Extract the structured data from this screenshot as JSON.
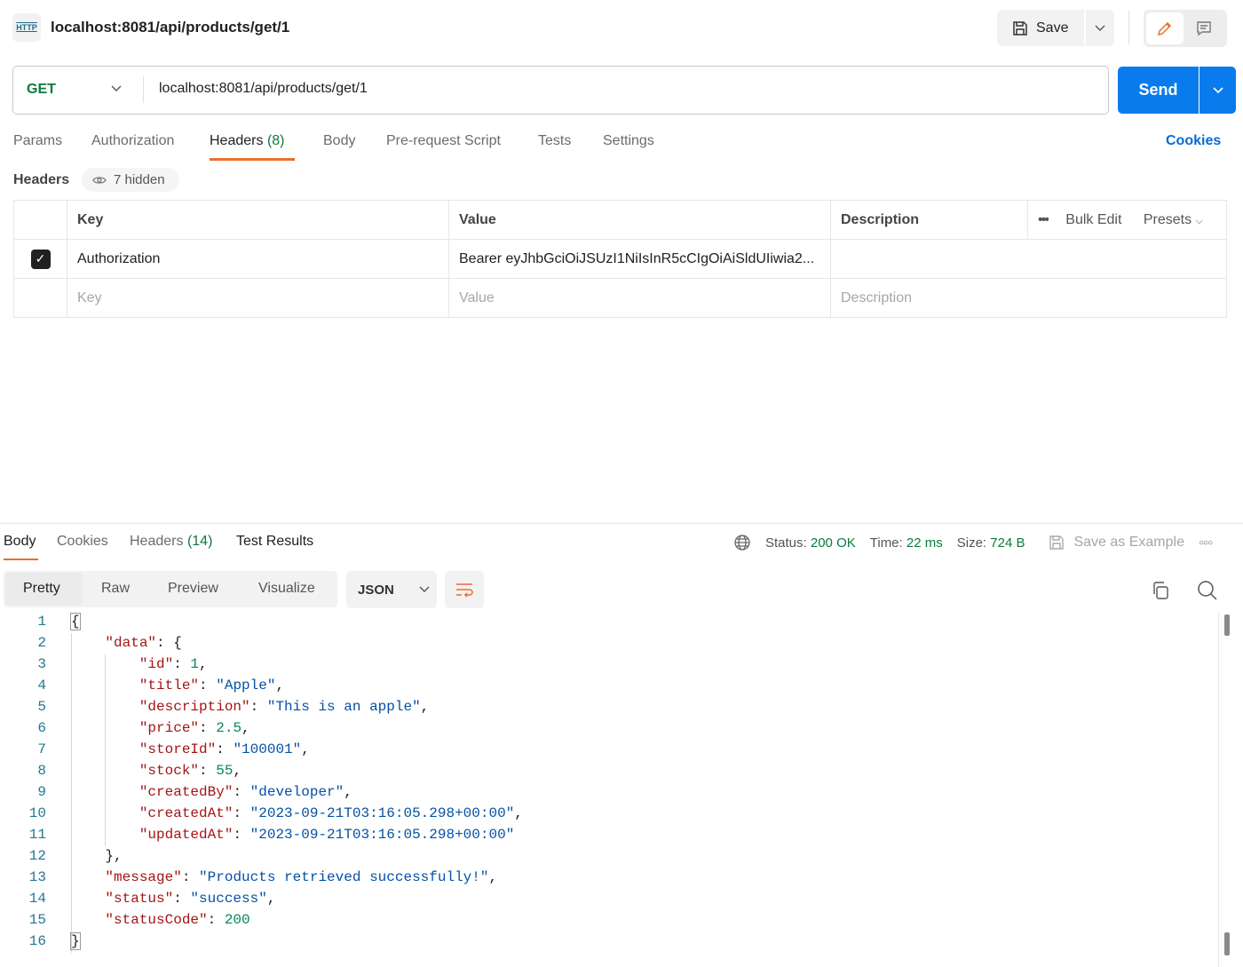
{
  "header": {
    "title": "localhost:8081/api/products/get/1",
    "icon_text": "HTTP",
    "save_label": "Save"
  },
  "request": {
    "method": "GET",
    "url": "localhost:8081/api/products/get/1",
    "send_label": "Send"
  },
  "tabs": [
    {
      "label": "Params"
    },
    {
      "label": "Authorization"
    },
    {
      "label": "Headers",
      "count": "(8)",
      "active": true
    },
    {
      "label": "Body"
    },
    {
      "label": "Pre-request Script"
    },
    {
      "label": "Tests"
    },
    {
      "label": "Settings"
    }
  ],
  "cookies_label": "Cookies",
  "headers_section": {
    "label": "Headers",
    "hidden": "7 hidden"
  },
  "table": {
    "columns": {
      "key": "Key",
      "value": "Value",
      "description": "Description",
      "bulk_edit": "Bulk Edit",
      "presets": "Presets"
    },
    "rows": [
      {
        "checked": true,
        "key": "Authorization",
        "value": "Bearer eyJhbGciOiJSUzI1NiIsInR5cCIgOiAiSldUIiwia2...",
        "description": ""
      }
    ],
    "placeholder": {
      "key": "Key",
      "value": "Value",
      "description": "Description"
    }
  },
  "response": {
    "tabs": [
      {
        "label": "Body",
        "active": true
      },
      {
        "label": "Cookies"
      },
      {
        "label": "Headers",
        "count": "(14)"
      },
      {
        "label": "Test Results"
      }
    ],
    "status_label": "Status:",
    "status": "200 OK",
    "time_label": "Time:",
    "time": "22 ms",
    "size_label": "Size:",
    "size": "724 B",
    "save_example": "Save as Example",
    "views": [
      "Pretty",
      "Raw",
      "Preview",
      "Visualize"
    ],
    "format": "JSON",
    "colors": {
      "key": "#a31515",
      "string": "#0451a5",
      "number": "#098658"
    },
    "lines": [
      [
        [
          "p",
          "{"
        ]
      ],
      [
        [
          "p",
          "    "
        ],
        [
          "k",
          "\"data\""
        ],
        [
          "p",
          ": {"
        ]
      ],
      [
        [
          "p",
          "        "
        ],
        [
          "k",
          "\"id\""
        ],
        [
          "p",
          ": "
        ],
        [
          "n",
          "1"
        ],
        [
          "p",
          ","
        ]
      ],
      [
        [
          "p",
          "        "
        ],
        [
          "k",
          "\"title\""
        ],
        [
          "p",
          ": "
        ],
        [
          "s",
          "\"Apple\""
        ],
        [
          "p",
          ","
        ]
      ],
      [
        [
          "p",
          "        "
        ],
        [
          "k",
          "\"description\""
        ],
        [
          "p",
          ": "
        ],
        [
          "s",
          "\"This is an apple\""
        ],
        [
          "p",
          ","
        ]
      ],
      [
        [
          "p",
          "        "
        ],
        [
          "k",
          "\"price\""
        ],
        [
          "p",
          ": "
        ],
        [
          "n",
          "2.5"
        ],
        [
          "p",
          ","
        ]
      ],
      [
        [
          "p",
          "        "
        ],
        [
          "k",
          "\"storeId\""
        ],
        [
          "p",
          ": "
        ],
        [
          "s",
          "\"100001\""
        ],
        [
          "p",
          ","
        ]
      ],
      [
        [
          "p",
          "        "
        ],
        [
          "k",
          "\"stock\""
        ],
        [
          "p",
          ": "
        ],
        [
          "n",
          "55"
        ],
        [
          "p",
          ","
        ]
      ],
      [
        [
          "p",
          "        "
        ],
        [
          "k",
          "\"createdBy\""
        ],
        [
          "p",
          ": "
        ],
        [
          "s",
          "\"developer\""
        ],
        [
          "p",
          ","
        ]
      ],
      [
        [
          "p",
          "        "
        ],
        [
          "k",
          "\"createdAt\""
        ],
        [
          "p",
          ": "
        ],
        [
          "s",
          "\"2023-09-21T03:16:05.298+00:00\""
        ],
        [
          "p",
          ","
        ]
      ],
      [
        [
          "p",
          "        "
        ],
        [
          "k",
          "\"updatedAt\""
        ],
        [
          "p",
          ": "
        ],
        [
          "s",
          "\"2023-09-21T03:16:05.298+00:00\""
        ]
      ],
      [
        [
          "p",
          "    },"
        ]
      ],
      [
        [
          "p",
          "    "
        ],
        [
          "k",
          "\"message\""
        ],
        [
          "p",
          ": "
        ],
        [
          "s",
          "\"Products retrieved successfully!\""
        ],
        [
          "p",
          ","
        ]
      ],
      [
        [
          "p",
          "    "
        ],
        [
          "k",
          "\"status\""
        ],
        [
          "p",
          ": "
        ],
        [
          "s",
          "\"success\""
        ],
        [
          "p",
          ","
        ]
      ],
      [
        [
          "p",
          "    "
        ],
        [
          "k",
          "\"statusCode\""
        ],
        [
          "p",
          ": "
        ],
        [
          "n",
          "200"
        ]
      ],
      [
        [
          "p",
          "}"
        ]
      ]
    ]
  }
}
